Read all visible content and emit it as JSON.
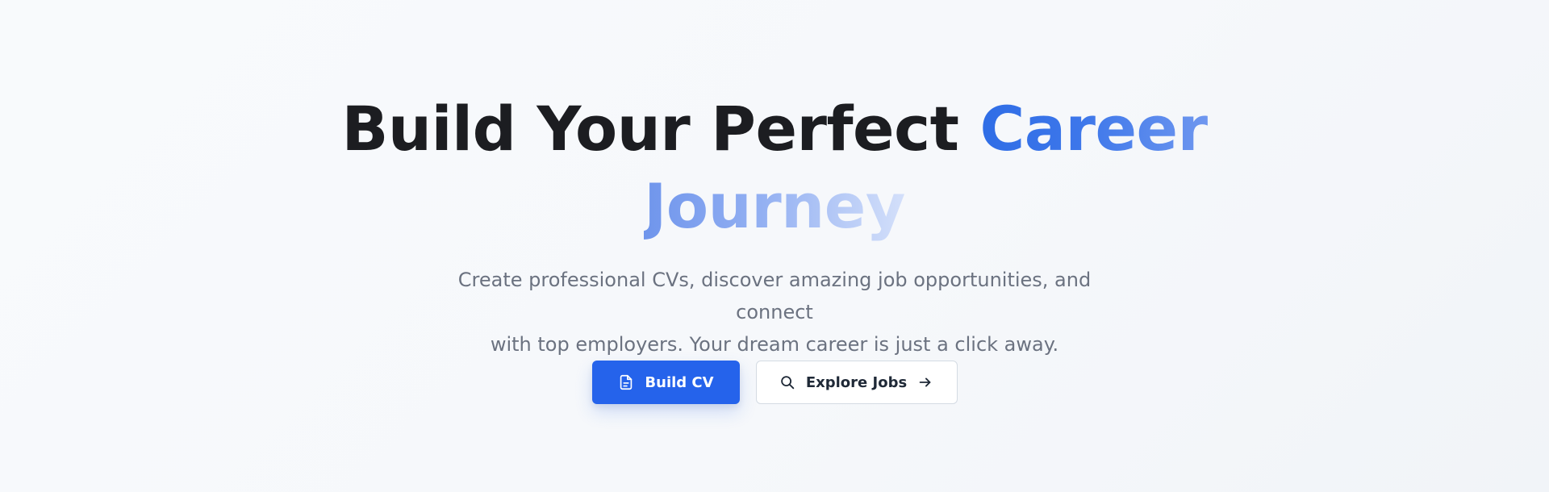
{
  "hero": {
    "headline": {
      "line1_prefix": "Build Your Perfect ",
      "line1_accent": "Career",
      "line2_accent": "Journey"
    },
    "subtitle": {
      "line1": "Create professional CVs, discover amazing job opportunities, and connect",
      "line2": "with top employers. Your dream career is just a click away."
    },
    "actions": {
      "build_cv_label": "Build CV",
      "explore_jobs_label": "Explore Jobs"
    },
    "icons": {
      "build_cv": "document-icon",
      "explore_jobs": "search-icon",
      "explore_jobs_trailing": "arrow-right-icon"
    },
    "colors": {
      "primary": "#2563eb",
      "headline": "#1c1d21",
      "subtitle": "#6b7280",
      "accent_start": "#2f6de6",
      "accent_end": "#d4e0fa"
    }
  }
}
